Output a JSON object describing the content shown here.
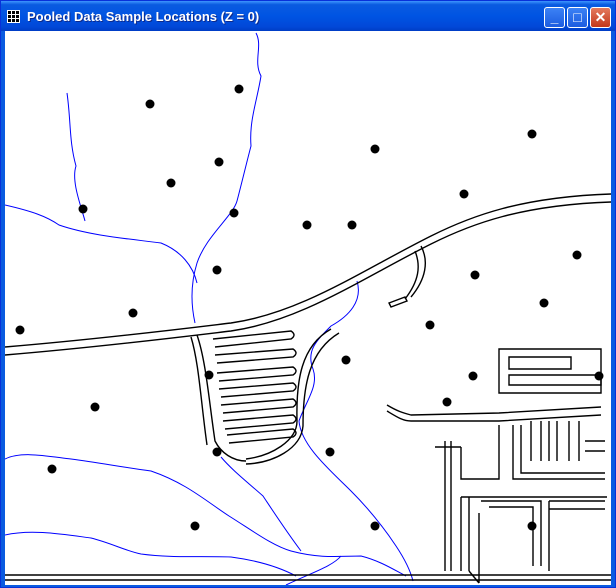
{
  "window": {
    "title": "Pooled Data Sample Locations (Z = 0)",
    "minimize_label": "_",
    "maximize_label": "□",
    "close_label": "✕"
  },
  "colors": {
    "titlebar": "#0054e3",
    "streams": "#0000ff",
    "roads": "#000000",
    "sample_points": "#000000",
    "background": "#ffffff"
  },
  "icons": {
    "app": "grid-icon",
    "minimize": "minimize-icon",
    "maximize": "maximize-icon",
    "close": "close-icon"
  }
}
